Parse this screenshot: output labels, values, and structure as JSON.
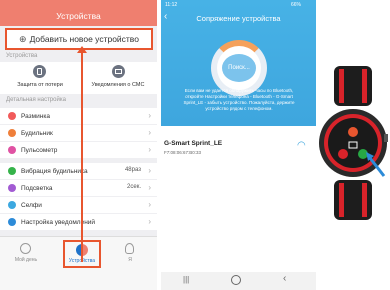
{
  "left": {
    "title": "Устройства",
    "add_device": "Добавить новое устройство",
    "section_devices": "Устройства",
    "anti_loss": "Защита от потери",
    "sms": "Уведомления о СМС",
    "section_detail": "Детальная настройка",
    "rows": [
      {
        "label": "Разминка",
        "color": "#f15a5a"
      },
      {
        "label": "Будильник",
        "color": "#ef7f3a"
      },
      {
        "label": "Пульсометр",
        "color": "#e052a3"
      }
    ],
    "rows2": [
      {
        "label": "Вибрация будильника",
        "value": "48раз",
        "color": "#35b34a"
      },
      {
        "label": "Подсветка",
        "value": "2сек.",
        "color": "#a25bd3"
      },
      {
        "label": "Селфи",
        "value": "",
        "color": "#3ca8e0"
      }
    ],
    "rows3": [
      {
        "label": "Настройка уведомлений",
        "color": "#2d8bd8"
      }
    ],
    "tabs": [
      "Мой день",
      "Устройства",
      "Я"
    ]
  },
  "right": {
    "status_time": "11:12",
    "status_right": "66%",
    "title": "Сопряжение устройства",
    "search": "Поиск...",
    "info": "Если вам не удается обнаружить часы по Bluetooth, откройте Настройки телефона - Bluetooth - G-Smart Sprint_LE - забыть устройство. Пожалуйста, держите устройство рядом с телефоном.",
    "device_name": "G-Smart Sprint_LE",
    "device_mac": "F7:08:06:67:B0:33"
  },
  "colors": {
    "accent": "#e8562f",
    "header": "#ef7f6f",
    "blue": "#3ea6de",
    "watch_red": "#d8232a"
  }
}
